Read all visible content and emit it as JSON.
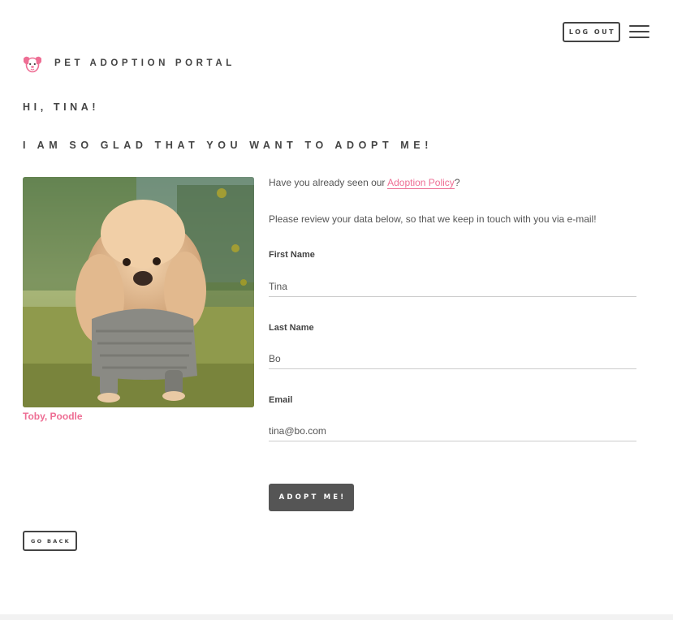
{
  "header": {
    "logout_label": "LOG OUT",
    "menu_icon": "hamburger-menu-icon",
    "brand_name": "PET ADOPTION PORTAL",
    "brand_icon": "dog-face-icon"
  },
  "main": {
    "greeting": "HI, TINA!",
    "subheading": "I AM SO GLAD THAT YOU WANT TO ADOPT ME!",
    "pet": {
      "caption": "Toby, Poodle"
    },
    "intro": {
      "prefix": "Have you already seen our ",
      "link_label": "Adoption Policy",
      "suffix": "?"
    },
    "review_text": "Please review your data below, so that we keep in touch with you via e-mail!",
    "form": {
      "first_name": {
        "label": "First Name",
        "value": "Tina"
      },
      "last_name": {
        "label": "Last Name",
        "value": "Bo"
      },
      "email": {
        "label": "Email",
        "value": "tina@bo.com"
      }
    },
    "adopt_label": "ADOPT ME!",
    "go_back_label": "GO BACK"
  },
  "colors": {
    "accent": "#ee6e94",
    "text": "#444444",
    "button_dark": "#555555"
  }
}
